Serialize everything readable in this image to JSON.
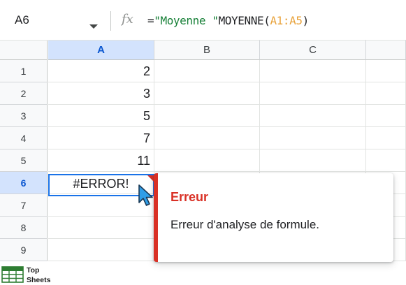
{
  "name_box": {
    "value": "A6"
  },
  "formula": {
    "parts": [
      {
        "text": "=",
        "kind": "eq"
      },
      {
        "text": "\"Moyenne \"",
        "kind": "str"
      },
      {
        "text": "MOYENNE(",
        "kind": "fn"
      },
      {
        "text": "A1:A5",
        "kind": "ref"
      },
      {
        "text": ")",
        "kind": "fn"
      }
    ]
  },
  "columns": [
    "A",
    "B",
    "C"
  ],
  "rows": [
    "1",
    "2",
    "3",
    "4",
    "5",
    "6",
    "7",
    "8",
    "9"
  ],
  "cells": {
    "A1": "2",
    "A2": "3",
    "A3": "5",
    "A4": "7",
    "A5": "11",
    "A6": "#ERROR!"
  },
  "selected": {
    "column": "A",
    "row": "6"
  },
  "error_tooltip": {
    "title": "Erreur",
    "message": "Erreur d'analyse de formule."
  },
  "watermark": {
    "line1": "Top",
    "line2": "Sheets"
  },
  "colors": {
    "header_selected_bg": "#d3e3fd",
    "header_selected_text": "#0b57d0",
    "selection_border": "#1a73e8",
    "error_red": "#d93025",
    "string_green": "#188038",
    "range_orange": "#e8a23a"
  },
  "icons": {
    "formula": "fx-icon",
    "dropdown": "chevron-down-icon",
    "pointer": "cursor-icon",
    "logo": "top-sheets-logo"
  }
}
